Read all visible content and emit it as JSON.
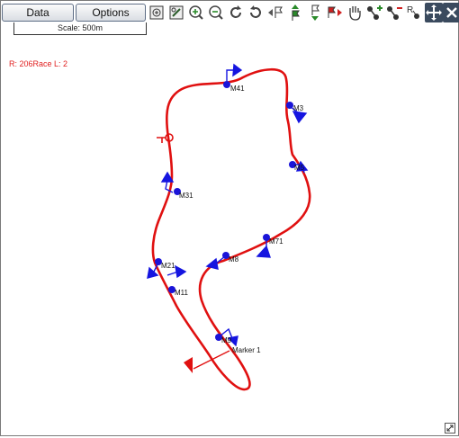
{
  "tabs": {
    "data_label": "Data",
    "options_label": "Options"
  },
  "toolbar": {
    "buttons": [
      {
        "icon": "zoom-extent-icon"
      },
      {
        "icon": "zoom-window-icon"
      },
      {
        "icon": "zoom-in-icon"
      },
      {
        "icon": "zoom-out-icon"
      },
      {
        "icon": "rotate-cw-icon"
      },
      {
        "icon": "rotate-ccw-icon"
      },
      {
        "icon": "previous-flag-icon"
      },
      {
        "icon": "flag-up-icon"
      },
      {
        "icon": "flag-down-icon"
      },
      {
        "icon": "next-flag-icon"
      },
      {
        "icon": "pan-hand-icon"
      },
      {
        "icon": "add-marker-icon"
      },
      {
        "icon": "remove-marker-icon"
      },
      {
        "icon": "rename-marker-icon"
      },
      {
        "icon": "move-icon"
      },
      {
        "icon": "close-icon"
      }
    ]
  },
  "map": {
    "scale_label": "Scale: 500m",
    "status_text": "R: 206Race  L: 2",
    "markers": [
      {
        "label": "M41"
      },
      {
        "label": "M3"
      },
      {
        "label": "M5"
      },
      {
        "label": "M31"
      },
      {
        "label": "M71"
      },
      {
        "label": "M8"
      },
      {
        "label": "M21"
      },
      {
        "label": "M11"
      },
      {
        "label": "M9"
      },
      {
        "label": "Marker 1"
      }
    ]
  },
  "colors": {
    "track": "#e01010",
    "marker": "#1a14d8",
    "arrow": "#1515e0",
    "flag": "#e01010"
  }
}
